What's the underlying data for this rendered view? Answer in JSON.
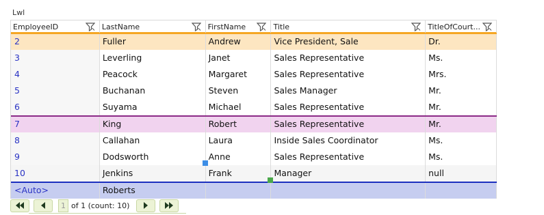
{
  "window_title": "Lwl",
  "columns": [
    "EmployeeID",
    "LastName",
    "FirstName",
    "Title",
    "TitleOfCourt..."
  ],
  "rows": [
    [
      "2",
      "Fuller",
      "Andrew",
      "Vice President, Sale",
      "Dr."
    ],
    [
      "3",
      "Leverling",
      "Janet",
      "Sales Representative",
      "Ms."
    ],
    [
      "4",
      "Peacock",
      "Margaret",
      "Sales Representative",
      "Mrs."
    ],
    [
      "5",
      "Buchanan",
      "Steven",
      "Sales Manager",
      "Mr."
    ],
    [
      "6",
      "Suyama",
      "Michael",
      "Sales Representative",
      "Mr."
    ],
    [
      "7",
      "King",
      "Robert",
      "Sales Representative",
      "Mr."
    ],
    [
      "8",
      "Callahan",
      "Laura",
      "Inside Sales Coordinator",
      "Ms."
    ],
    [
      "9",
      "Dodsworth",
      "Anne",
      "Sales Representative",
      "Ms."
    ],
    [
      "10",
      "Jenkins",
      "Frank",
      "Manager",
      "null"
    ]
  ],
  "new_row": [
    "<Auto>",
    "Roberts",
    "",
    "",
    ""
  ],
  "pager": {
    "page": "1",
    "of_count": "of 1 (count: 10)"
  },
  "icons": {
    "filter": "filter-funnel-icon",
    "first": "first-page-icon",
    "prev": "prev-page-icon",
    "next": "next-page-icon",
    "last": "last-page-icon"
  },
  "colors": {
    "accent_header": "#f5a623",
    "selected_row": "#fde6c1",
    "hover_row": "#f1d3ef",
    "new_row": "#c6cdf0",
    "id_text": "#2a33c4"
  }
}
